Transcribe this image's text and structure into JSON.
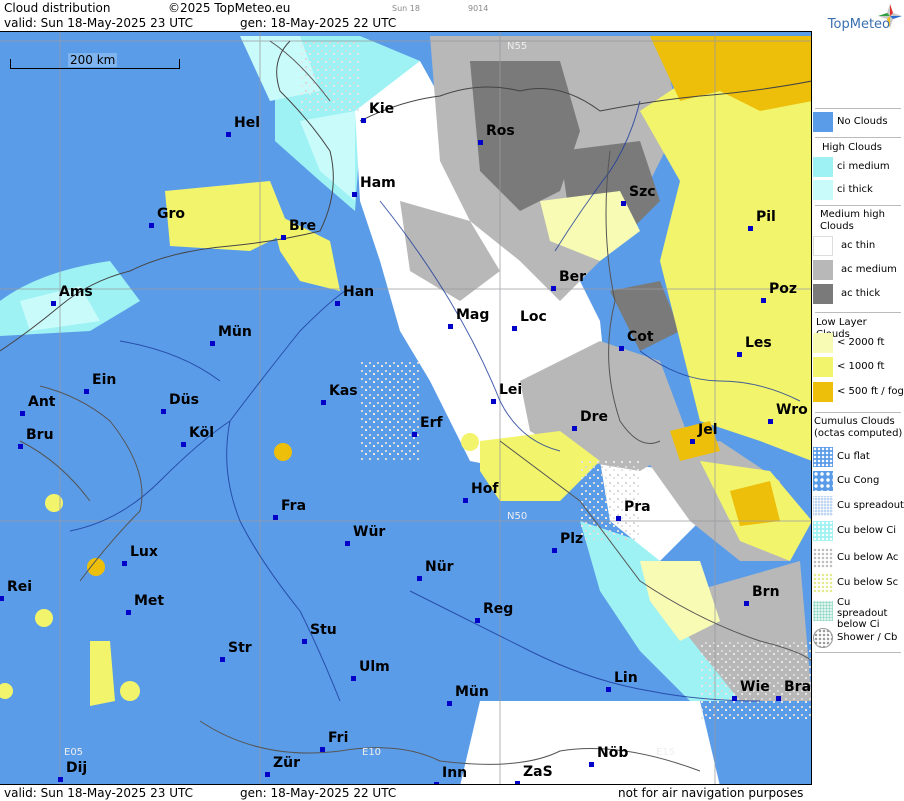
{
  "header": {
    "product": "Cloud distribution",
    "copyright": "©2025 TopMeteo.eu",
    "tiny_day": "Sun 18",
    "tiny_code": "9014",
    "valid": "valid:  Sun  18-May-2025  23 UTC",
    "gen": "gen: 18-May-2025 22 UTC"
  },
  "footer": {
    "valid": "valid:  Sun  18-May-2025  23 UTC",
    "gen": "gen: 18-May-2025 22 UTC",
    "disclaimer": "not for air navigation purposes"
  },
  "map": {
    "scale_label": "200 km",
    "grid_labels": {
      "n55": "N55",
      "n50": "N50",
      "e05": "E05",
      "e10": "E10",
      "e15": "E15"
    },
    "cities": [
      "Kie",
      "Hel",
      "Ros",
      "Ham",
      "Szc",
      "Gro",
      "Bre",
      "Pil",
      "Ber",
      "Ams",
      "Han",
      "Poz",
      "Mag",
      "Loc",
      "Mün",
      "Cot",
      "Les",
      "Ein",
      "Kas",
      "Lei",
      "Ant",
      "Düs",
      "Wro",
      "Erf",
      "Dre",
      "Jel",
      "Bru",
      "Köl",
      "Hof",
      "Fra",
      "Pra",
      "Lux",
      "Plz",
      "Wür",
      "Nür",
      "Rei",
      "Met",
      "Reg",
      "Brn",
      "Stu",
      "Str",
      "Ulm",
      "Lin",
      "Wie",
      "Bra",
      "Mün",
      "Fri",
      "Nöb",
      "Dij",
      "Zür",
      "Inn",
      "ZaS"
    ]
  },
  "legend": {
    "brand": "TopMeteo",
    "no_clouds": "No Clouds",
    "high_clouds": "High Clouds",
    "ci_medium": "ci medium",
    "ci_thick": "ci thick",
    "medium_high": "Medium high Clouds",
    "ac_thin": "ac thin",
    "ac_medium": "ac medium",
    "ac_thick": "ac thick",
    "low_layer": "Low Layer Clouds",
    "lt2000": "< 2000 ft",
    "lt1000": "< 1000 ft",
    "lt500": "< 500 ft / fog",
    "cumulus": "Cumulus Clouds (octas computed)",
    "cu_flat": "Cu flat",
    "cu_cong": "Cu Cong",
    "cu_spread": "Cu spreadout",
    "cu_below_ci": "Cu below Ci",
    "cu_below_ac": "Cu below Ac",
    "cu_below_sc": "Cu below Sc",
    "cu_spread_below_ci": "Cu spreadout below Ci",
    "shower": "Shower / Cb"
  },
  "colors": {
    "no_clouds": "#5b9ce8",
    "ci_medium": "#9ef2f4",
    "ci_thick": "#c9fbfb",
    "ac_thin": "#ffffff",
    "ac_medium": "#b8b8b8",
    "ac_thick": "#7a7a7a",
    "low_2000": "#f7fbb4",
    "low_1000": "#f2f56c",
    "low_500": "#edbe0a",
    "city_marker": "#0000c8"
  }
}
